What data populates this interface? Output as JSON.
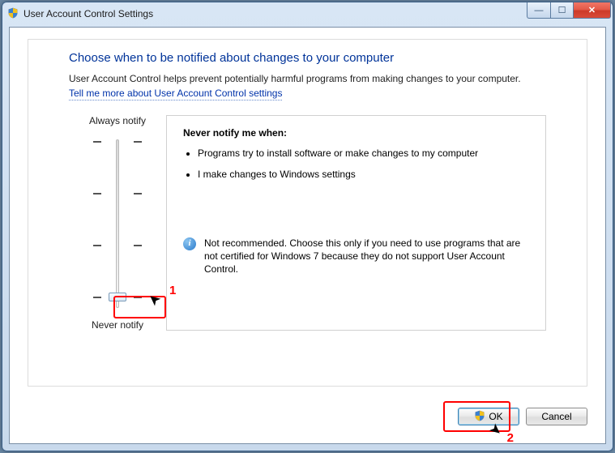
{
  "window": {
    "title": "User Account Control Settings"
  },
  "heading": "Choose when to be notified about changes to your computer",
  "intro": "User Account Control helps prevent potentially harmful programs from making changes to your computer.",
  "link_text": "Tell me more about User Account Control settings",
  "slider": {
    "top_label": "Always notify",
    "bottom_label": "Never notify",
    "position": 3
  },
  "description": {
    "title": "Never notify me when:",
    "bullets": [
      "Programs try to install software or make changes to my computer",
      "I make changes to Windows settings"
    ],
    "warning_icon": "info-icon",
    "warning": "Not recommended. Choose this only if you need to use programs that are not certified for Windows 7 because they do not support User Account Control."
  },
  "buttons": {
    "ok": "OK",
    "cancel": "Cancel"
  },
  "annotations": {
    "n1": "1",
    "n2": "2"
  },
  "window_controls": {
    "min": "—",
    "max": "☐",
    "close": "✕"
  }
}
